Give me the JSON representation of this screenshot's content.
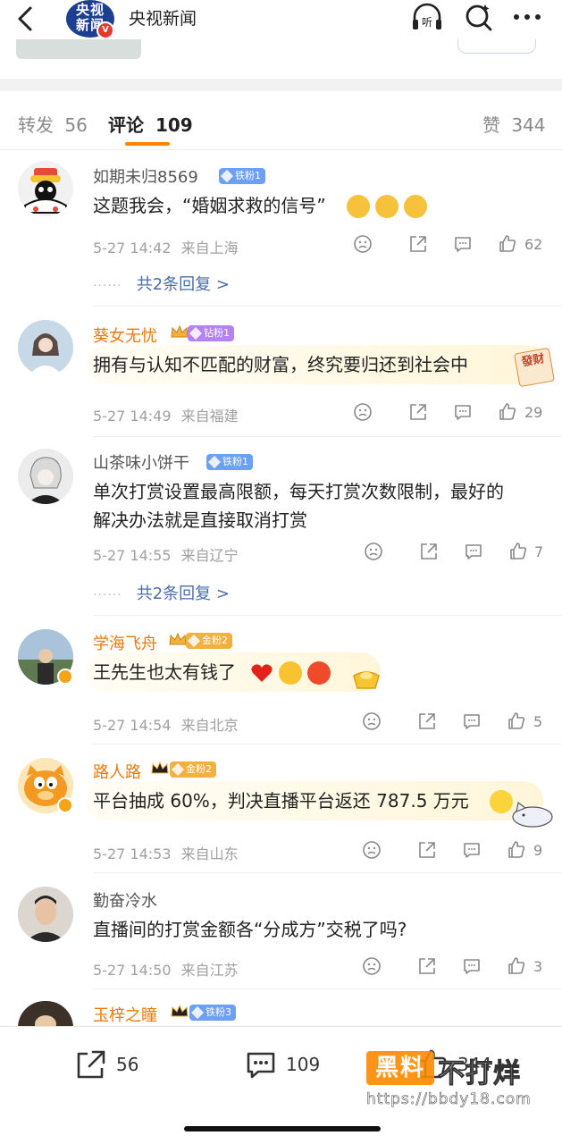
{
  "header": {
    "title": "央视新闻",
    "logo_text": "央视新闻",
    "listen_label": "听",
    "back_icon": "back-arrow-icon",
    "search_icon": "search-icon",
    "more_icon": "more-icon"
  },
  "tabs": {
    "repost_label": "转发",
    "repost_count": "56",
    "comment_label": "评论",
    "comment_count": "109",
    "like_label": "赞",
    "like_count": "344"
  },
  "comments": [
    {
      "user": "如期未归8569",
      "fan_badge": "铁粉1",
      "text": "这题我会，“婚姻求救的信号”",
      "time": "5-27 14:42",
      "location": "来自上海",
      "likes": "62",
      "replies": "共2条回复 >"
    },
    {
      "user": "葵女无忧",
      "fan_badge": "钻粉1",
      "text": "拥有与认知不匹配的财富，终究要归还到社会中",
      "sticker": "發财",
      "time": "5-27 14:49",
      "location": "来自福建",
      "likes": "29"
    },
    {
      "user": "山茶味小饼干",
      "fan_badge": "铁粉1",
      "text_line1": "单次打赏设置最高限额，每天打赏次数限制，最好的",
      "text_line2": "解决办法就是直接取消打赏",
      "time": "5-27 14:55",
      "location": "来自辽宁",
      "likes": "7",
      "replies": "共2条回复 >"
    },
    {
      "user": "学海飞舟",
      "fan_badge": "金粉2",
      "text": "王先生也太有钱了",
      "time": "5-27 14:54",
      "location": "来自北京",
      "likes": "5"
    },
    {
      "user": "路人路",
      "fan_badge": "金粉2",
      "text": "平台抽成 60%，判决直播平台返还 787.5 万元",
      "time": "5-27 14:53",
      "location": "来自山东",
      "likes": "9"
    },
    {
      "user": "勤奋冷水",
      "text": "直播间的打赏金额各“分成方”交税了吗?",
      "time": "5-27 14:50",
      "location": "来自江苏",
      "likes": "3"
    },
    {
      "user": "玉梓之瞳",
      "fan_badge": "铁粉3"
    }
  ],
  "bottom": {
    "repost_count": "56",
    "comment_count": "109",
    "like_count": "344"
  },
  "watermark": {
    "brand_box": "黑料",
    "brand_text": "不打烊",
    "url": "https://bbdy18.com"
  },
  "colors": {
    "accent": "#ff8200",
    "vip_name": "#eb7a0e",
    "reply_link": "#4a6ea9",
    "iron_fan": "#6d9ff5",
    "drill_fan": "#b582f5",
    "gold_fan": "#f4b03e"
  }
}
